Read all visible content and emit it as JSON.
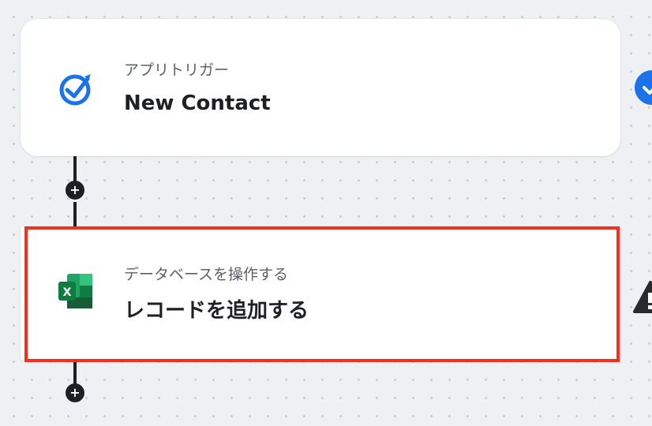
{
  "flow": {
    "steps": [
      {
        "subtitle": "アプリトリガー",
        "title": "New Contact",
        "icon": "contact-app-checkmark-icon",
        "status_icon": "check-circle-icon",
        "accent": "#1a73e8"
      },
      {
        "subtitle": "データベースを操作する",
        "title": "レコードを追加する",
        "icon": "excel-icon",
        "status_icon": "warning-icon",
        "accent": "#1d7044"
      }
    ],
    "add_step_label": "+",
    "colors": {
      "highlight": "#f2301f",
      "connector": "#1e1f24",
      "background": "#eef0f3"
    }
  }
}
